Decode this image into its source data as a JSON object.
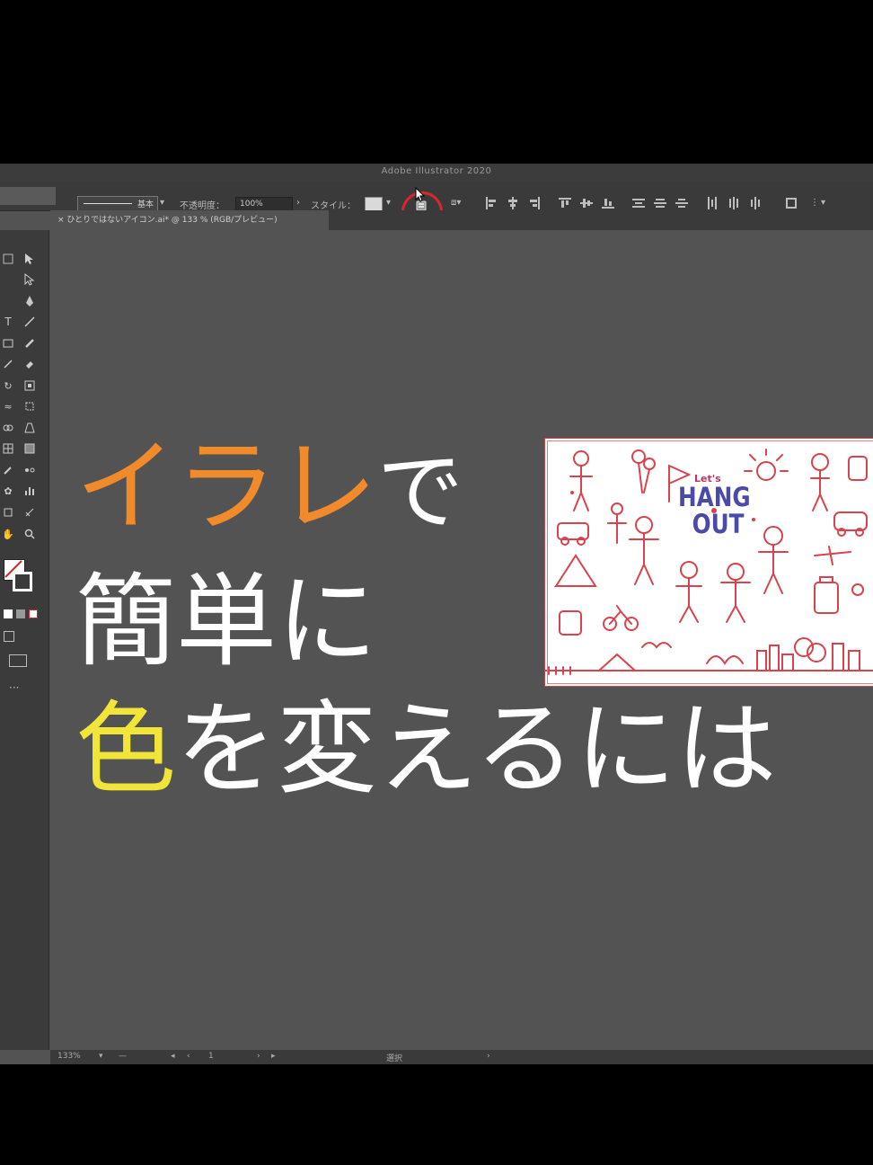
{
  "app": {
    "window_title": "Adobe Illustrator 2020",
    "control_bar": {
      "stroke_label": "基本",
      "opacity_label": "不透明度：",
      "opacity_value": "100%",
      "style_label": "スタイル：",
      "more_label": "⋮"
    },
    "document_tab": "× ひとりではないアイコン.ai* @ 133 % (RGB/プレビュー)",
    "status_bar": {
      "zoom": "133%",
      "page": "1",
      "mode": "選択"
    }
  },
  "headline": {
    "line1_orange": "イラレ",
    "line1_white": "で",
    "line2": "簡単に",
    "line3_yellow": "色",
    "line3_white": "を変えるには"
  },
  "artwork": {
    "lets": "Let's",
    "title_line1": "HANG",
    "title_line2": "OUT"
  },
  "colors": {
    "accent_orange": "#f08a2a",
    "accent_yellow": "#f2e53a",
    "highlight_ring": "#d8262b",
    "illustration_red": "#d8434d",
    "illustration_blue": "#4a4aa8"
  },
  "icons": {
    "recolor_artwork": "recolor-artwork-icon",
    "cursor": "mouse-cursor-icon"
  }
}
